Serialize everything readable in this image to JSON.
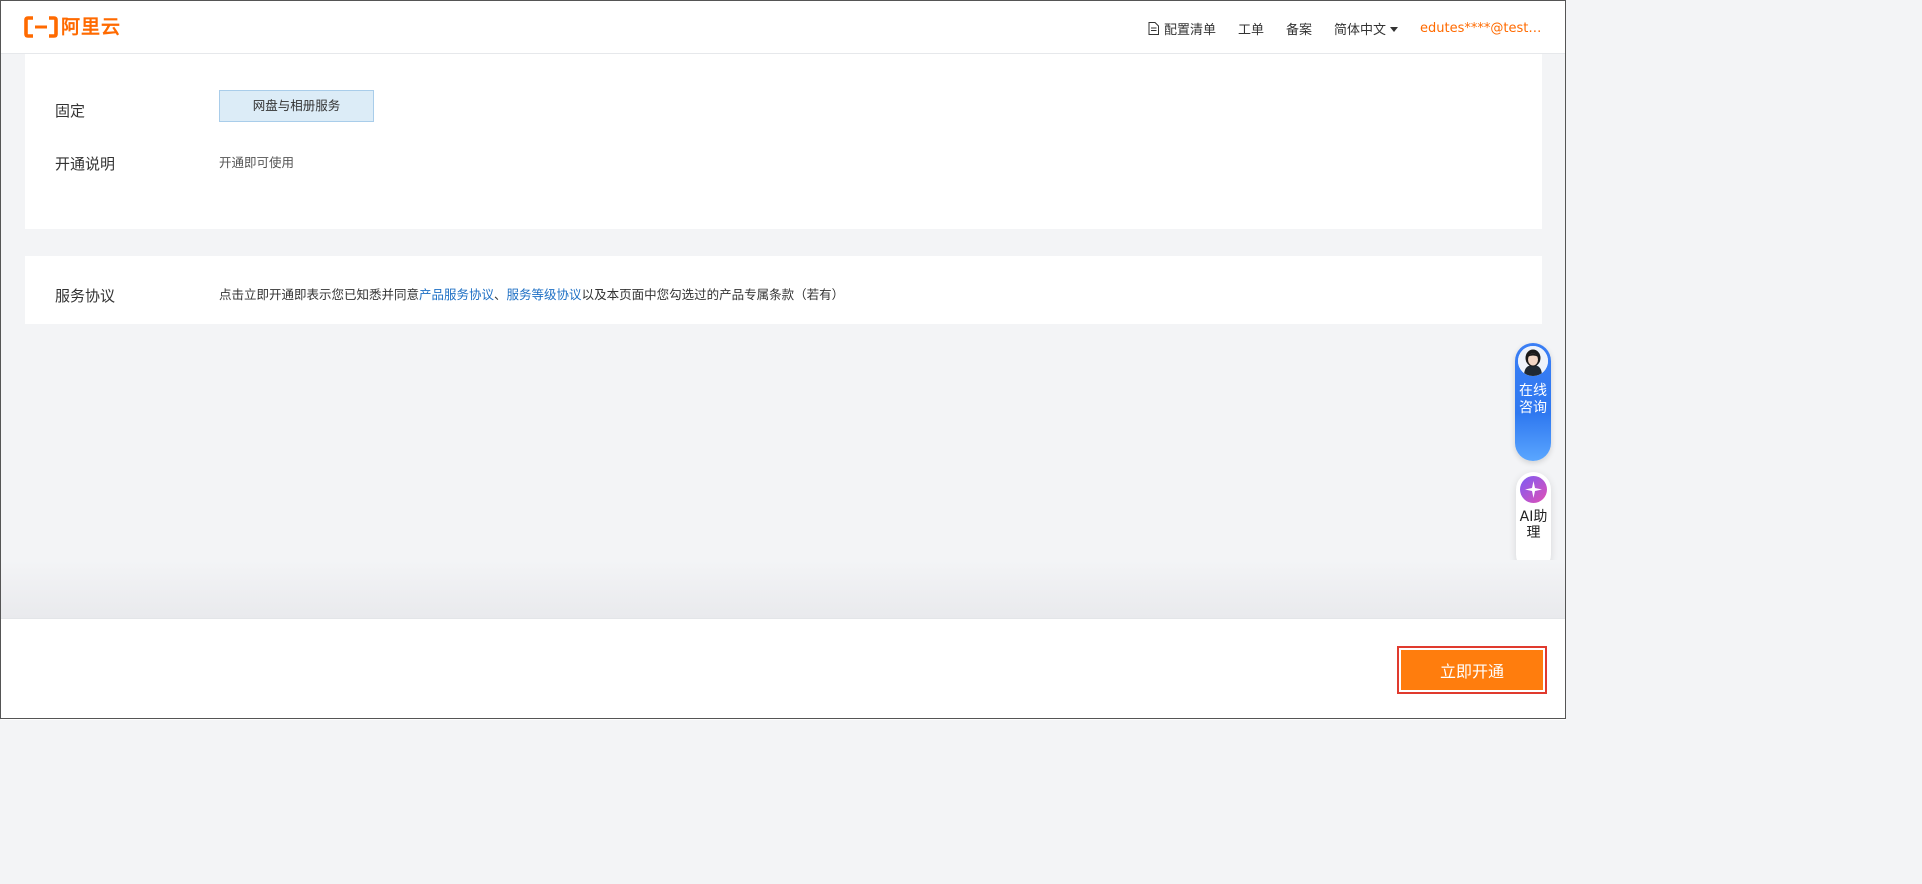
{
  "header": {
    "logo_text": "阿里云",
    "brand_color": "#ff6a00",
    "nav": {
      "config_list": "配置清单",
      "ticket": "工单",
      "filing": "备案",
      "language": "简体中文",
      "account": "edutes****@test.aliy..."
    }
  },
  "config": {
    "fixed_label": "固定",
    "fixed_option": "网盘与相册服务",
    "activation_label": "开通说明",
    "activation_value": "开通即可使用"
  },
  "agreement": {
    "label": "服务协议",
    "text_before": "点击立即开通即表示您已知悉并同意",
    "link1": "产品服务协议",
    "separator": "、",
    "link2": "服务等级协议",
    "text_after": "以及本页面中您勾选过的产品专属条款（若有）"
  },
  "floating": {
    "consult_label": "在线咨询",
    "ai_label": "AI助理"
  },
  "footer": {
    "submit_label": "立即开通"
  },
  "colors": {
    "accent": "#ff7d0d",
    "link": "#1d6fc4",
    "selected_bg": "#dcecf7"
  }
}
